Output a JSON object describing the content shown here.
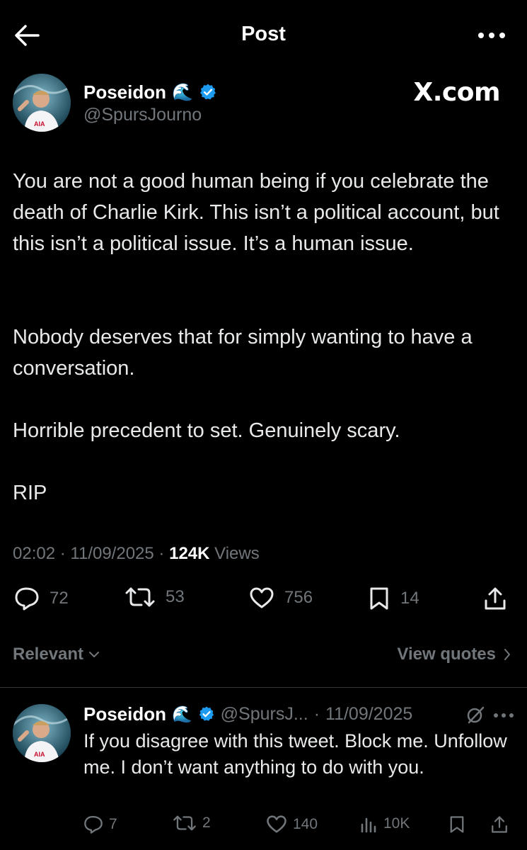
{
  "header": {
    "title": "Post"
  },
  "post": {
    "author_name": "Poseidon",
    "author_emoji": "🌊",
    "author_handle": "@SpursJourno",
    "watermark": "X.com",
    "paragraphs": [
      "You are not a good human being if you celebrate the death of Charlie Kirk. This isn’t a political account, but this isn’t a political issue. It’s a human issue.",
      "Nobody deserves that for simply wanting to have a conversation.",
      "Horrible precedent to set. Genuinely scary.",
      "RIP"
    ],
    "time": "02:02",
    "date": "11/09/2025",
    "views_count": "124K",
    "views_label": "Views",
    "stats": {
      "replies": "72",
      "reposts": "53",
      "likes": "756",
      "bookmarks": "14"
    }
  },
  "sort": {
    "label": "Relevant",
    "view_quotes_label": "View quotes"
  },
  "reply": {
    "author_name": "Poseidon",
    "author_emoji": "🌊",
    "handle": "@SpursJ...",
    "date": "11/09/2025",
    "text": "If you disagree with this tweet. Block me. Unfollow me. I don’t want anything to do with you.",
    "stats": {
      "replies": "7",
      "reposts": "2",
      "likes": "140",
      "views": "10K"
    }
  },
  "colors": {
    "background": "#000000",
    "text": "#e7e9ea",
    "muted": "#71767b",
    "verified": "#1d9bf0",
    "divider": "#2f3336"
  }
}
